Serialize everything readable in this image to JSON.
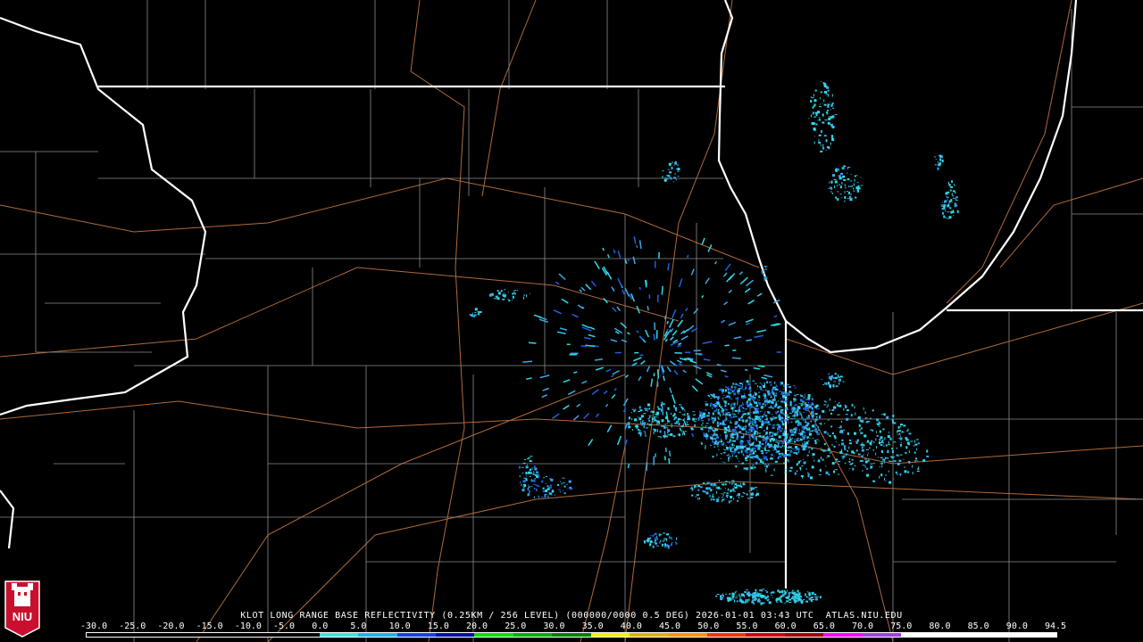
{
  "caption": "KLOT LONG RANGE BASE REFLECTIVITY (0.25KM / 256 LEVEL) (000000/0000 0.5 DEG) 2026-01-01 03:43 UTC  ATLAS.NIU.EDU",
  "scale": {
    "ticks": [
      "-30.0",
      "-25.0",
      "-20.0",
      "-15.0",
      "-10.0",
      "-5.0",
      "0.0",
      "5.0",
      "10.0",
      "15.0",
      "20.0",
      "25.0",
      "30.0",
      "35.0",
      "40.0",
      "45.0",
      "50.0",
      "55.0",
      "60.0",
      "65.0",
      "70.0",
      "75.0",
      "80.0",
      "85.0",
      "90.0",
      "94.5"
    ],
    "colors": [
      "#000000",
      "#000000",
      "#000000",
      "#000000",
      "#000000",
      "#000000",
      "#40e0e0",
      "#20b0e8",
      "#1040f0",
      "#0010a0",
      "#00e000",
      "#00b000",
      "#008000",
      "#f0f000",
      "#e0b000",
      "#ff9000",
      "#ff3000",
      "#d00000",
      "#a00000",
      "#ff00ff",
      "#a040e0",
      "#ffffff",
      "#ffffff",
      "#ffffff",
      "#ffffff"
    ]
  },
  "logo": {
    "text": "NIU",
    "color": "#c8102e"
  },
  "colors": {
    "county_lines": "#8a8a8a",
    "state_lines": "#ffffff",
    "roads": "#b06a3a",
    "echo_light": "#30d8e8",
    "echo_mid": "#3aa8e8",
    "echo_strong": "#2060e0"
  }
}
